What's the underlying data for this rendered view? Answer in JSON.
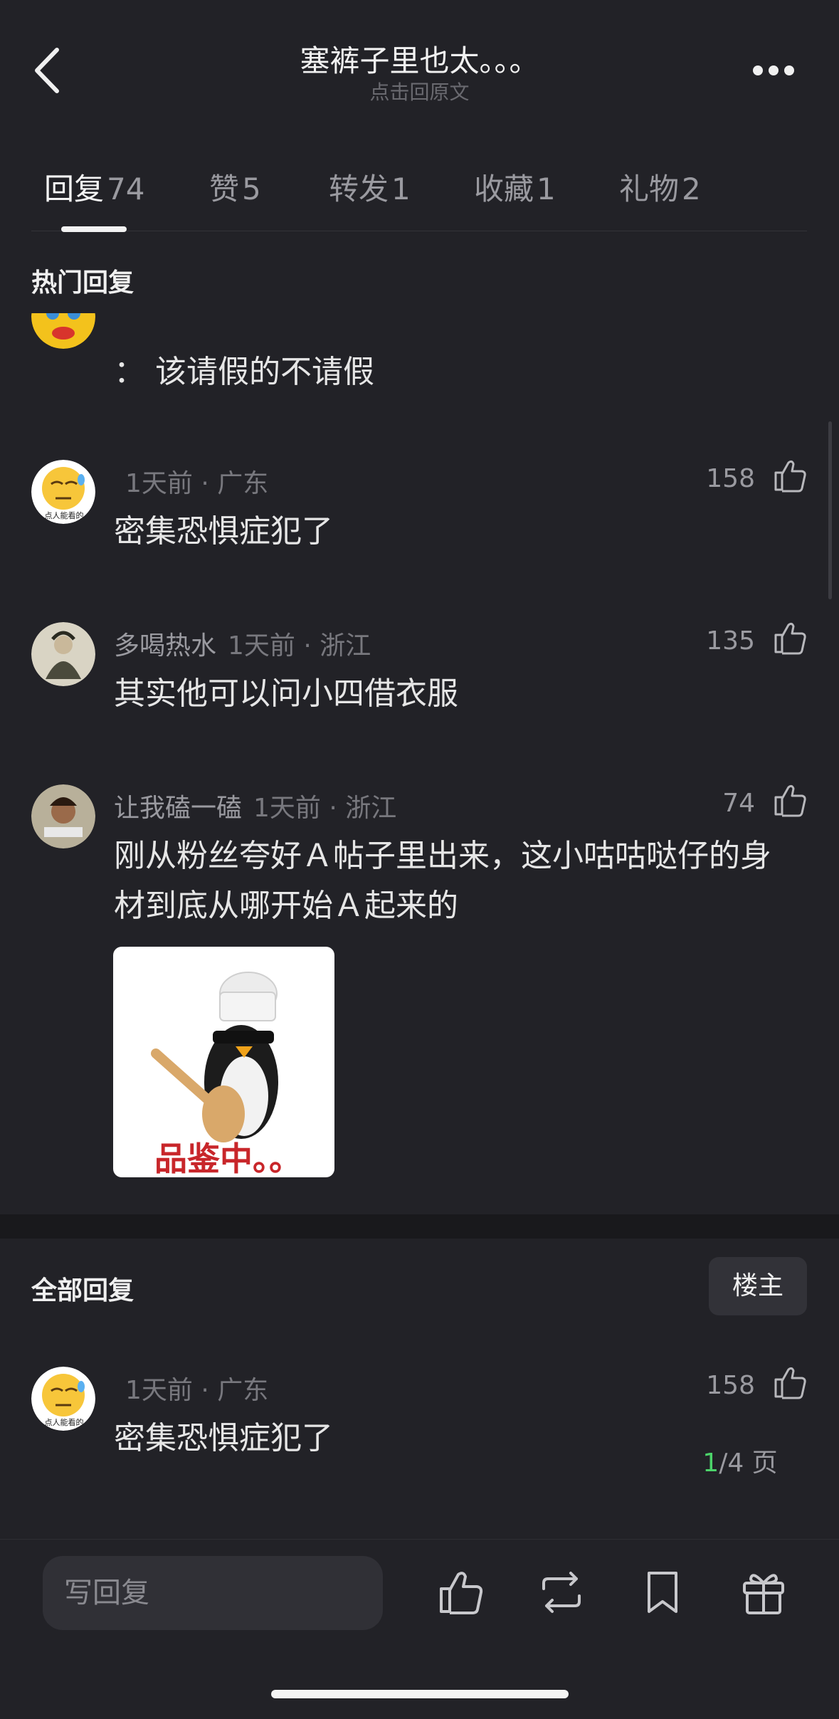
{
  "header": {
    "title": "塞裤子里也太。。。",
    "subtitle": "点击回原文",
    "back_icon": "chevron-left-icon",
    "more_icon": "more-dots-icon"
  },
  "tabs": [
    {
      "label": "回复",
      "count": "74",
      "active": true
    },
    {
      "label": "赞",
      "count": "5",
      "active": false
    },
    {
      "label": "转发",
      "count": "1",
      "active": false
    },
    {
      "label": "收藏",
      "count": "1",
      "active": false
    },
    {
      "label": "礼物",
      "count": "2",
      "active": false
    }
  ],
  "hot": {
    "section_title": "热门回复",
    "comments": [
      {
        "name": "",
        "time": "",
        "location": "",
        "likes": "",
        "text": "： 该请假的不请假"
      },
      {
        "name": "",
        "time": "1天前",
        "location": "广东",
        "likes": "158",
        "text": "密集恐惧症犯了",
        "avatar_caption": "点人能看的"
      },
      {
        "name": "多喝热水",
        "time": "1天前",
        "location": "浙江",
        "likes": "135",
        "text": "其实他可以问小四借衣服"
      },
      {
        "name": "让我磕一磕",
        "time": "1天前",
        "location": "浙江",
        "likes": "74",
        "text": "刚从粉丝夸好Ａ帖子里出来，这小咕咕哒仔的身材到底从哪开始Ａ起来的",
        "image_caption": "品鉴中。。"
      }
    ]
  },
  "all": {
    "section_title": "全部回复",
    "op_button": "楼主",
    "comments": [
      {
        "name": "",
        "time": "1天前",
        "location": "广东",
        "likes": "158",
        "text": "密集恐惧症犯了",
        "avatar_caption": "点人能看的"
      }
    ],
    "pager": {
      "current": "1",
      "total": "/4 页"
    }
  },
  "bottom_bar": {
    "reply_placeholder": "写回复",
    "icons": [
      "thumb-up-icon",
      "repost-icon",
      "bookmark-icon",
      "gift-icon"
    ]
  },
  "colors": {
    "background": "#222227",
    "pager_current": "#4cd46a"
  }
}
